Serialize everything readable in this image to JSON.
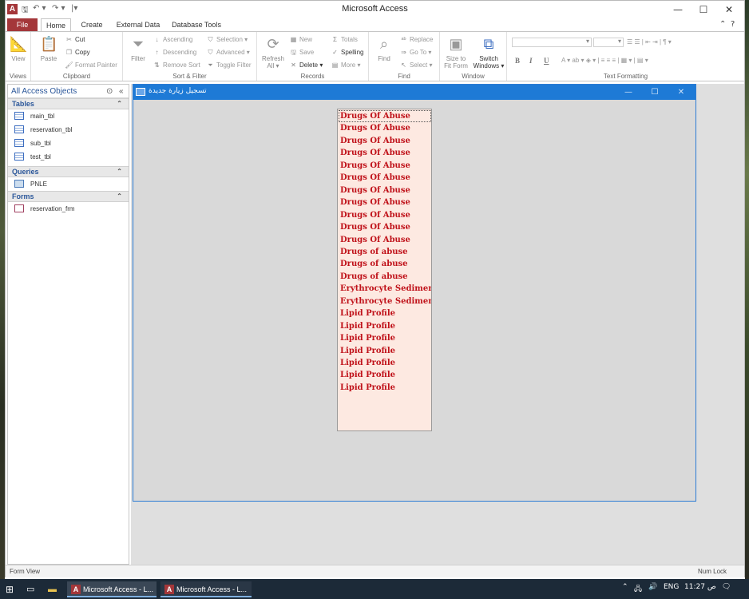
{
  "app": {
    "title": "Microsoft Access",
    "minimize": "—",
    "maximize": "☐",
    "close": "✕",
    "help": "?"
  },
  "quick_access": {
    "save": "🖫",
    "undo": "↶ ▾",
    "redo": "↷ ▾",
    "customize": "|▾"
  },
  "tabs": [
    "File",
    "Home",
    "Create",
    "External Data",
    "Database Tools"
  ],
  "ribbon": {
    "views": {
      "label": "Views",
      "view": "View"
    },
    "clipboard": {
      "label": "Clipboard",
      "paste": "Paste",
      "cut": "Cut",
      "copy": "Copy",
      "format_painter": "Format Painter"
    },
    "sort_filter": {
      "label": "Sort & Filter",
      "filter": "Filter",
      "ascending": "Ascending",
      "descending": "Descending",
      "remove_sort": "Remove Sort",
      "selection": "Selection ▾",
      "advanced": "Advanced ▾",
      "toggle_filter": "Toggle Filter"
    },
    "records": {
      "label": "Records",
      "refresh": "Refresh",
      "refresh2": "All ▾",
      "new": "New",
      "save": "Save",
      "delete": "Delete ▾",
      "totals": "Totals",
      "spelling": "Spelling",
      "more": "More ▾"
    },
    "find": {
      "label": "Find",
      "find": "Find",
      "replace": "Replace",
      "goto": "Go To ▾",
      "select": "Select ▾"
    },
    "window": {
      "label": "Window",
      "size_to_fit": "Size to",
      "size_to_fit2": "Fit Form",
      "switch": "Switch",
      "switch2": "Windows ▾"
    },
    "text_formatting": {
      "label": "Text Formatting",
      "bold": "B",
      "italic": "I",
      "underline": "U"
    }
  },
  "nav": {
    "header": "All Access Objects",
    "sections": [
      {
        "title": "Tables",
        "items": [
          "main_tbl",
          "reservation_tbl",
          "sub_tbl",
          "test_tbl"
        ]
      },
      {
        "title": "Queries",
        "items": [
          "PNLE"
        ]
      },
      {
        "title": "Forms",
        "items": [
          "reservation_frm"
        ]
      }
    ]
  },
  "form": {
    "title": "تسجيل زيارة جديدة",
    "list_items": [
      "Drugs Of Abuse",
      "Drugs Of Abuse",
      "Drugs Of Abuse",
      "Drugs Of Abuse",
      "Drugs Of Abuse",
      "Drugs Of Abuse",
      "Drugs Of Abuse",
      "Drugs Of Abuse",
      "Drugs Of Abuse",
      "Drugs Of Abuse",
      "Drugs Of Abuse",
      "Drugs of abuse",
      "Drugs of abuse",
      "Drugs of abuse",
      "Erythrocyte Sedimen",
      "Erythrocyte Sedimen",
      "Lipid Profile",
      "Lipid Profile",
      "Lipid Profile",
      "Lipid Profile",
      "Lipid Profile",
      "Lipid Profile",
      "Lipid Profile"
    ]
  },
  "status": {
    "left": "Form View",
    "right": "Num Lock"
  },
  "taskbar": {
    "apps": [
      "Microsoft Access - L...",
      "Microsoft Access - L..."
    ],
    "lang": "ENG",
    "time": "11:27 ص"
  },
  "colors": {
    "accent": "#a4373a",
    "form_titlebar": "#1e7ad6",
    "list_text": "#c0121a",
    "list_bg": "#fde9e1"
  }
}
